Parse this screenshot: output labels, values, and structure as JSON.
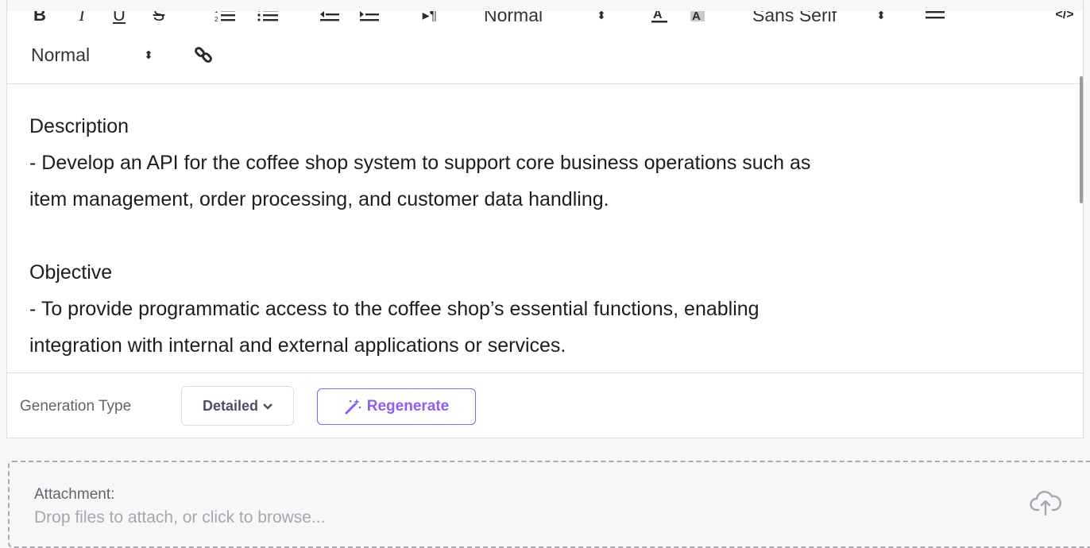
{
  "toolbar": {
    "bold": "B",
    "italic": "I",
    "underline": "U",
    "strike": "S",
    "ordered_list_icon": "ordered-list-icon",
    "bullet_list_icon": "bullet-list-icon",
    "outdent_icon": "outdent-icon",
    "indent_icon": "indent-icon",
    "direction_icon": "text-direction-icon",
    "header_select": "Normal",
    "text_color_icon": "text-color-icon",
    "background_color_icon": "background-color-icon",
    "font_select": "Sans Serif",
    "align_icon": "align-icon",
    "code_icon": "code-block-icon",
    "size_select": "Normal",
    "link_icon": "link-icon"
  },
  "content": {
    "heading1": "Description",
    "line1a": "- Develop an API for the coffee shop system to support core business operations such as",
    "line1b": "item management, order processing, and customer data handling.",
    "heading2": "Objective",
    "line2a": "- To provide programmatic access to the coffee shop’s essential functions, enabling",
    "line2b": "integration with internal and external applications or services."
  },
  "generation": {
    "label": "Generation Type",
    "selected": "Detailed",
    "regenerate_label": "Regenerate"
  },
  "attachment": {
    "label": "Attachment:",
    "hint": "Drop files to attach, or click to browse..."
  },
  "colors": {
    "accent": "#8e5cf7",
    "border": "#dcdcde",
    "muted_text": "#5f6570",
    "hint_text": "#a3a8b2"
  }
}
